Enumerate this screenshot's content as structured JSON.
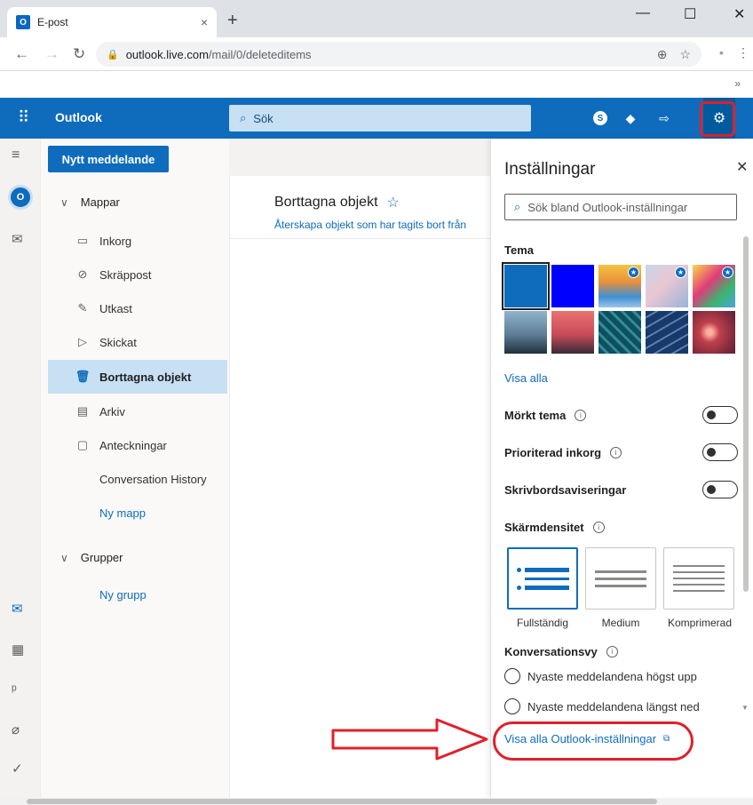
{
  "browser": {
    "tab_title": "E-post",
    "tab_close": "×",
    "new_tab": "+",
    "url_host": "outlook.live.com",
    "url_path": "/mail/0/deleteditems",
    "bookmarks_more": "»",
    "minimize": "—",
    "maximize": "☐",
    "close": "✕"
  },
  "header": {
    "brand": "Outlook",
    "search_placeholder": "Sök"
  },
  "folder_pane": {
    "new_message": "Nytt meddelande",
    "folders_section": "Mappar",
    "folders": [
      {
        "label": "Inkorg"
      },
      {
        "label": "Skräppost"
      },
      {
        "label": "Utkast"
      },
      {
        "label": "Skickat"
      },
      {
        "label": "Borttagna objekt"
      },
      {
        "label": "Arkiv"
      },
      {
        "label": "Anteckningar"
      },
      {
        "label": "Conversation History"
      }
    ],
    "new_folder": "Ny mapp",
    "groups_section": "Grupper",
    "new_group": "Ny grupp"
  },
  "message_list": {
    "title": "Borttagna objekt",
    "star": "☆",
    "subtitle": "Återskapa objekt som har tagits bort från"
  },
  "settings": {
    "title": "Inställningar",
    "close": "✕",
    "search_placeholder": "Sök bland Outlook-inställningar",
    "theme_label": "Tema",
    "show_all": "Visa alla",
    "dark_theme": "Mörkt tema",
    "focused_inbox": "Prioriterad inkorg",
    "desktop_notifications": "Skrivbordsaviseringar",
    "density_label": "Skärmdensitet",
    "density_options": [
      "Fullständig",
      "Medium",
      "Komprimerad"
    ],
    "conversation_view": "Konversationsvy",
    "radio_newest_top": "Nyaste meddelandena högst upp",
    "radio_newest_bottom": "Nyaste meddelandena längst ned",
    "all_settings": "Visa alla Outlook-inställningar"
  },
  "colors": {
    "brand_blue": "#0f6cbd",
    "annotation_red": "#e0202a"
  }
}
